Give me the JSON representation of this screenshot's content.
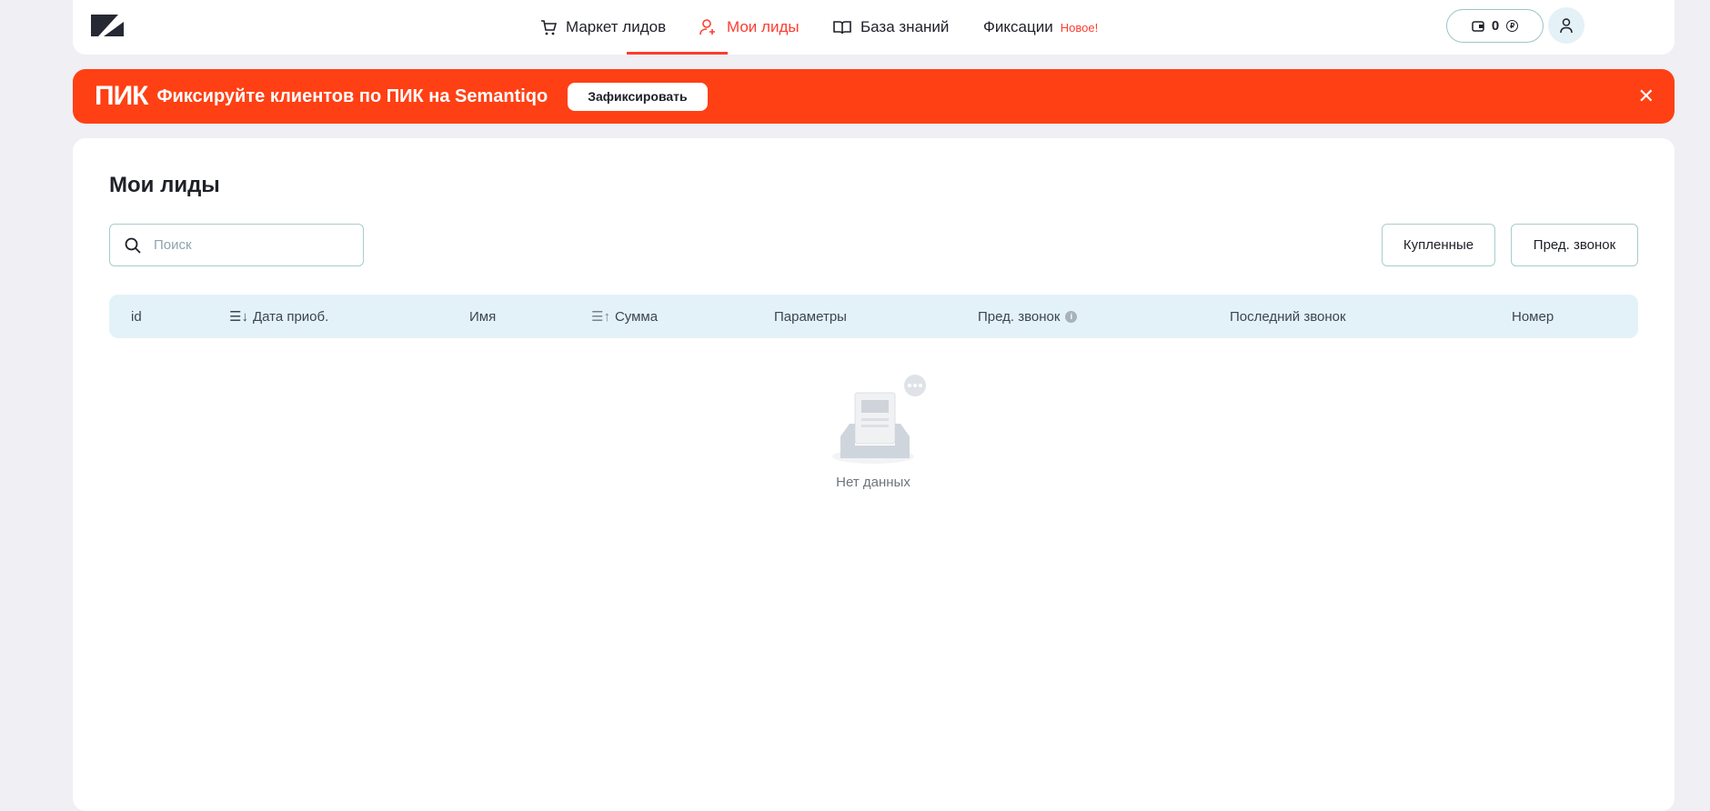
{
  "nav": {
    "items": [
      {
        "label": "Маркет лидов",
        "icon": "cart-icon"
      },
      {
        "label": "Мои лиды",
        "icon": "user-plus-icon",
        "active": true
      },
      {
        "label": "База знаний",
        "icon": "book-icon"
      },
      {
        "label": "Фиксации",
        "badge": "Новое!"
      }
    ],
    "balance": "0",
    "currency": "₽"
  },
  "banner": {
    "brand": "ПИК",
    "text": "Фиксируйте клиентов по ПИК на Semantiqo",
    "button": "Зафиксировать"
  },
  "page": {
    "title": "Мои лиды",
    "search_placeholder": "Поиск",
    "filters": [
      "Купленные",
      "Пред. звонок"
    ]
  },
  "table": {
    "columns": [
      "id",
      "Дата приоб.",
      "Имя",
      "Сумма",
      "Параметры",
      "Пред. звонок",
      "Последний звонок",
      "Номер"
    ],
    "empty": "Нет данных"
  },
  "colors": {
    "accent": "#ff3c2f",
    "banner": "#ff4014"
  }
}
